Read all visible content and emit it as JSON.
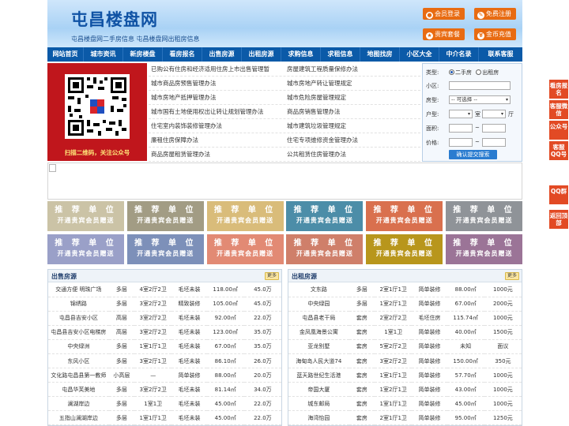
{
  "header": {
    "logo": "屯昌楼盘网",
    "slogan": "屯昌楼盘网二手房信息    屯昌楼盘网出租房信息",
    "buttons": [
      {
        "label": "会员登录",
        "icon": "user-icon"
      },
      {
        "label": "免费注册",
        "icon": "edit-icon"
      },
      {
        "label": "贵宾套餐",
        "icon": "vip-icon"
      },
      {
        "label": "金币充值",
        "icon": "coin-icon"
      }
    ]
  },
  "nav": [
    "网站首页",
    "城市资讯",
    "新房楼盘",
    "看房报名",
    "出售房源",
    "出租房源",
    "求购信息",
    "求租信息",
    "地图找房",
    "小区大全",
    "中介名录",
    "联系客服"
  ],
  "qr": {
    "caption": "扫描二维码，关注公众号"
  },
  "news": [
    [
      "已购公有住房和经济适用住房上市出售管理暂",
      "房屋建筑工程质量保修办法"
    ],
    [
      "城市商品房预售管理办法",
      "城市房地产转让管理规定"
    ],
    [
      "城市房地产抵押管理办法",
      "城市危险房屋管理规定"
    ],
    [
      "城市国有土地使用权出让转让规划管理办法",
      "商品房销售管理办法"
    ],
    [
      "住宅室内装饰装修管理办法",
      "城市建筑垃圾管理规定"
    ],
    [
      "廉租住房保障办法",
      "住宅专项维修资金管理办法"
    ],
    [
      "商品房屋租赁管理办法",
      "公共租赁住房管理办法"
    ]
  ],
  "search": {
    "type_label": "类型:",
    "type_options": [
      "二手房",
      "出租房"
    ],
    "community_label": "小区:",
    "housetype_label": "房型:",
    "housetype_value": "-- 可选择 --",
    "unit_label": "户型:",
    "room_unit": "室",
    "hall_unit": "厅",
    "area_label": "面积:",
    "price_label": "价格:",
    "range_sep": "~",
    "submit": "确认提交搜索"
  },
  "recs": {
    "title": "推 荐 单 位",
    "subtitle": "开通贵宾会员赠送",
    "colors": [
      "#cbc3a6",
      "#a29c84",
      "#d9bc7a",
      "#4c8da8",
      "#d9704e",
      "#8f9398",
      "#9aa0c8",
      "#7d90b9",
      "#e28a74",
      "#cf7f6a",
      "#b8961c",
      "#9b7497"
    ]
  },
  "sale": {
    "title": "出售房源",
    "more": "更多",
    "rows": [
      [
        "交通方便 明珠广场",
        "多层",
        "4室2厅2卫",
        "毛坯未装",
        "118.00㎡",
        "45.0万"
      ],
      [
        "锦绣路",
        "多层",
        "3室2厅2卫",
        "精致装修",
        "105.00㎡",
        "45.0万"
      ],
      [
        "屯昌县吉安小区",
        "高层",
        "3室2厅2卫",
        "毛坯未装",
        "92.00㎡",
        "22.0万"
      ],
      [
        "屯昌县吉安小区电梯房",
        "高层",
        "3室2厅2卫",
        "毛坯未装",
        "123.00㎡",
        "35.0万"
      ],
      [
        "中央绿洲",
        "多层",
        "1室1厅1卫",
        "毛坯未装",
        "67.00㎡",
        "35.0万"
      ],
      [
        "东风小区",
        "多层",
        "3室2厅1卫",
        "毛坯未装",
        "86.10㎡",
        "26.0万"
      ],
      [
        "文化路屯昌县第一教师",
        "小高层",
        "—",
        "简单装修",
        "88.00㎡",
        "20.0万"
      ],
      [
        "屯昌华芙美地",
        "多层",
        "3室2厅2卫",
        "毛坯未装",
        "81.14㎡",
        "34.0万"
      ],
      [
        "澜湖岸边",
        "多层",
        "1室1卫",
        "毛坯未装",
        "45.00㎡",
        "22.0万"
      ],
      [
        "五指山澜湖岸边",
        "多层",
        "1室1厅1卫",
        "毛坯未装",
        "45.00㎡",
        "22.0万"
      ]
    ]
  },
  "rent": {
    "title": "出租房源",
    "more": "更多",
    "rows": [
      [
        "文东路",
        "多层",
        "2室1厅1卫",
        "简单装修",
        "88.00㎡",
        "1000元"
      ],
      [
        "中央绿园",
        "多层",
        "1室2厅1卫",
        "简单装修",
        "67.00㎡",
        "2000元"
      ],
      [
        "屯昌县老干局",
        "套房",
        "2室2厅2卫",
        "毛坯住房",
        "115.74㎡",
        "1000元"
      ],
      [
        "金凤凰海景公寓",
        "套房",
        "1室1卫",
        "简单装修",
        "40.00㎡",
        "1500元"
      ],
      [
        "亚龙别墅",
        "套房",
        "5室2厅2卫",
        "简单装修",
        "未知",
        "面议"
      ],
      [
        "海甸岛人民大道74",
        "套房",
        "3室2厅2卫",
        "简单装修",
        "150.00㎡",
        "350元"
      ],
      [
        "蓝天路世纪生活港",
        "套房",
        "1室1厅1卫",
        "简单装修",
        "57.70㎡",
        "1000元"
      ],
      [
        "帝国大厦",
        "套房",
        "1室2厅1卫",
        "简单装修",
        "43.00㎡",
        "1000元"
      ],
      [
        "城东邮局",
        "套房",
        "1室1厅1卫",
        "简单装修",
        "45.00㎡",
        "1000元"
      ],
      [
        "海湾怡园",
        "套房",
        "2室1厅1卫",
        "简单装修",
        "95.00㎡",
        "1250元"
      ]
    ]
  },
  "float": [
    "看房报名",
    "客服微信",
    "公众号",
    "客服QQ号",
    "QQ群",
    "返回顶部"
  ]
}
